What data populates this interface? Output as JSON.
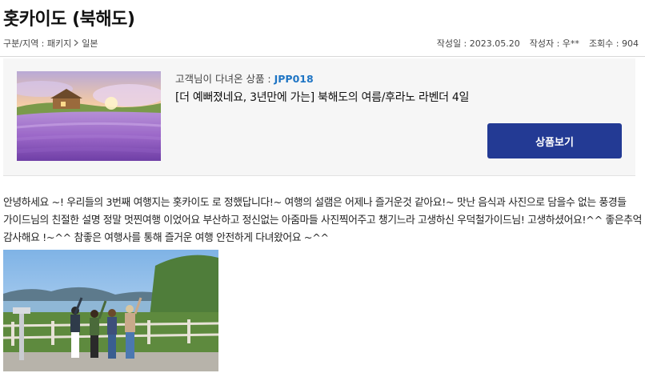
{
  "page_title": "홋카이도 (북해도)",
  "meta": {
    "category_label": "구분/지역 : 패키지",
    "region": "일본",
    "date": "작성일 : 2023.05.20",
    "author": "작성자 : 우**",
    "views": "조회수 : 904"
  },
  "product": {
    "label": "고객님이 다녀온 상품 : ",
    "code": "JPP018",
    "title": "[더 예뻐졌네요, 3년만에 가는] 북해도의 여름/후라노 라벤더 4일",
    "button_label": "상품보기"
  },
  "review": {
    "text": "안녕하세요 ~! 우리들의 3번째 여행지는 홋카이도 로 정했답니다!~ 여행의 설램은 어제나 즐거운것 같아요!~ 맛난 음식과 사진으로 담을수 없는 풍경들 가이드님의 친절한 설명 정말 멋찐여행 이었어요 부산하고 정신없는 아줌마들 사진찍어주고 챙기느라 고생하신 우덕철가이드님! 고생하셨어요!^^ 좋은추억 감사해요 !~^^ 참좋은 여행사를 통해 즐거운 여행 안전하게 다녀왔어요 ~^^"
  },
  "icons": {
    "breadcrumb_separator": "chevron-right-icon"
  },
  "colors": {
    "accent_button": "#233a94",
    "product_code": "#1f75c4",
    "product_box_bg": "#f6f6f6"
  }
}
